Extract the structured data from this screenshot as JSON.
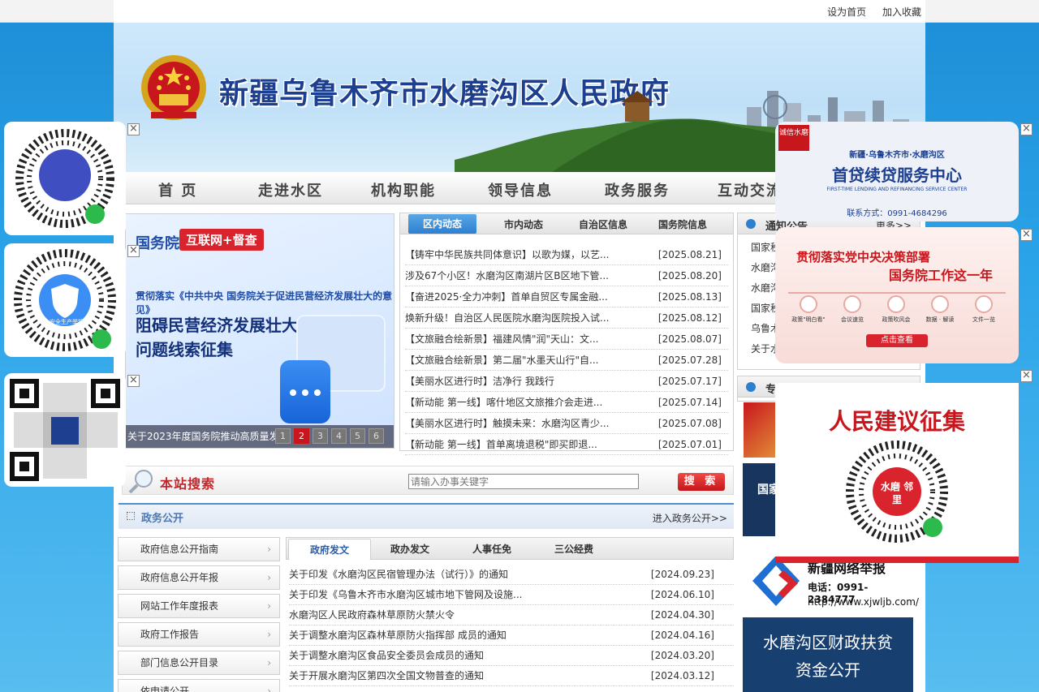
{
  "toplinks": {
    "home": "设为首页",
    "fav": "加入收藏"
  },
  "banner": {
    "title": "新疆乌鲁木齐市水磨沟区人民政府"
  },
  "nav": [
    "首 页",
    "走进水区",
    "机构职能",
    "领导信息",
    "政务服务",
    "互动交流"
  ],
  "slider": {
    "brand": "国务院",
    "tag": "互联网+督查",
    "line1": "贯彻落实《中共中央 国务院关于促进民营经济发展壮大的意见》",
    "line2": "阻碍民营经济发展壮大",
    "line3": "问题线索征集",
    "caption": "关于2023年度国务院推动高质量发",
    "pages": [
      "1",
      "2",
      "3",
      "4",
      "5",
      "6"
    ]
  },
  "news": {
    "tabs": [
      "区内动态",
      "市内动态",
      "自治区信息",
      "国务院信息"
    ],
    "items": [
      {
        "title": "【铸牢中华民族共同体意识】以歌为媒，以艺...",
        "date": "[2025.08.21]"
      },
      {
        "title": "涉及67个小区！水磨沟区南湖片区B区地下管...",
        "date": "[2025.08.20]"
      },
      {
        "title": "【奋进2025·全力冲刺】首单自贸区专属金融...",
        "date": "[2025.08.13]"
      },
      {
        "title": "焕新升级！自治区人民医院水磨沟医院投入试...",
        "date": "[2025.08.12]"
      },
      {
        "title": "【文旅融合绘新景】福建风情\"润\"天山：文...",
        "date": "[2025.08.07]"
      },
      {
        "title": "【文旅融合绘新景】第二届\"水墨天山行\"自...",
        "date": "[2025.07.28]"
      },
      {
        "title": "【美丽水区进行时】洁净行 我践行",
        "date": "[2025.07.17]"
      },
      {
        "title": "【新动能 第一线】喀什地区文旅推介会走进...",
        "date": "[2025.07.14]"
      },
      {
        "title": "【美丽水区进行时】触摸未来：水磨沟区青少...",
        "date": "[2025.07.08]"
      },
      {
        "title": "【新动能 第一线】首单离境退税\"即买即退...",
        "date": "[2025.07.01]"
      }
    ]
  },
  "search": {
    "label": "本站搜索",
    "placeholder": "请输入办事关键字",
    "button": "搜 索"
  },
  "zwgk": {
    "title": "政务公开",
    "more": "进入政务公开>>"
  },
  "leftmenu": [
    "政府信息公开指南",
    "政府信息公开年报",
    "网站工作年度报表",
    "政府工作报告",
    "部门信息公开目录",
    "依申请公开"
  ],
  "docs": {
    "tabs": [
      "政府发文",
      "政办发文",
      "人事任免",
      "三公经费"
    ],
    "items": [
      {
        "title": "关于印发《水磨沟区民宿管理办法（试行）》的通知",
        "date": "[2024.09.23]"
      },
      {
        "title": "关于印发《乌鲁木齐市水磨沟区城市地下管网及设施...",
        "date": "[2024.06.10]"
      },
      {
        "title": "水磨沟区人民政府森林草原防火禁火令",
        "date": "[2024.04.30]"
      },
      {
        "title": "关于调整水磨沟区森林草原防火指挥部 成员的通知",
        "date": "[2024.04.16]"
      },
      {
        "title": "关于调整水磨沟区食品安全委员会成员的通知",
        "date": "[2024.03.20]"
      },
      {
        "title": "关于开展水磨沟区第四次全国文物普查的通知",
        "date": "[2024.03.12]"
      }
    ]
  },
  "notice": {
    "title": "通知公告",
    "more": "更多>>",
    "items": [
      "国家税",
      "水磨沟",
      "水磨沟",
      "国家税",
      "乌鲁木",
      "关于水"
    ]
  },
  "special": {
    "title": "专题专栏"
  },
  "ads": {
    "loan": {
      "line1": "新疆·乌鲁木齐市·水磨沟区",
      "line2": "首贷续贷服务中心",
      "line3": "FIRST-TIME LENDING AND REFINANCING SERVICE CENTER",
      "phone": "联系方式：0991-4684296",
      "seal": "诚信水磨"
    },
    "gov": {
      "line1": "贯彻落实党中央决策部署",
      "line2": "国务院工作这一年",
      "items": [
        "政策\"明白看\"",
        "会议速览",
        "政策吹风会",
        "数据 · 解读",
        "文件一览"
      ],
      "btn": "点击查看"
    },
    "jianyi": {
      "title": "人民建议征集",
      "seal": "水磨 邻里"
    }
  },
  "qr": {
    "caption2": "安全生产举报"
  },
  "right_panels": {
    "p1": "国家",
    "xjwljb": {
      "name": "新疆网络举报",
      "phone": "电话：0991-2384777",
      "url": "http://www.xjwljb.com/"
    },
    "caizheng": {
      "line1": "水磨沟区财政扶贫",
      "line2": "资金公开"
    }
  }
}
